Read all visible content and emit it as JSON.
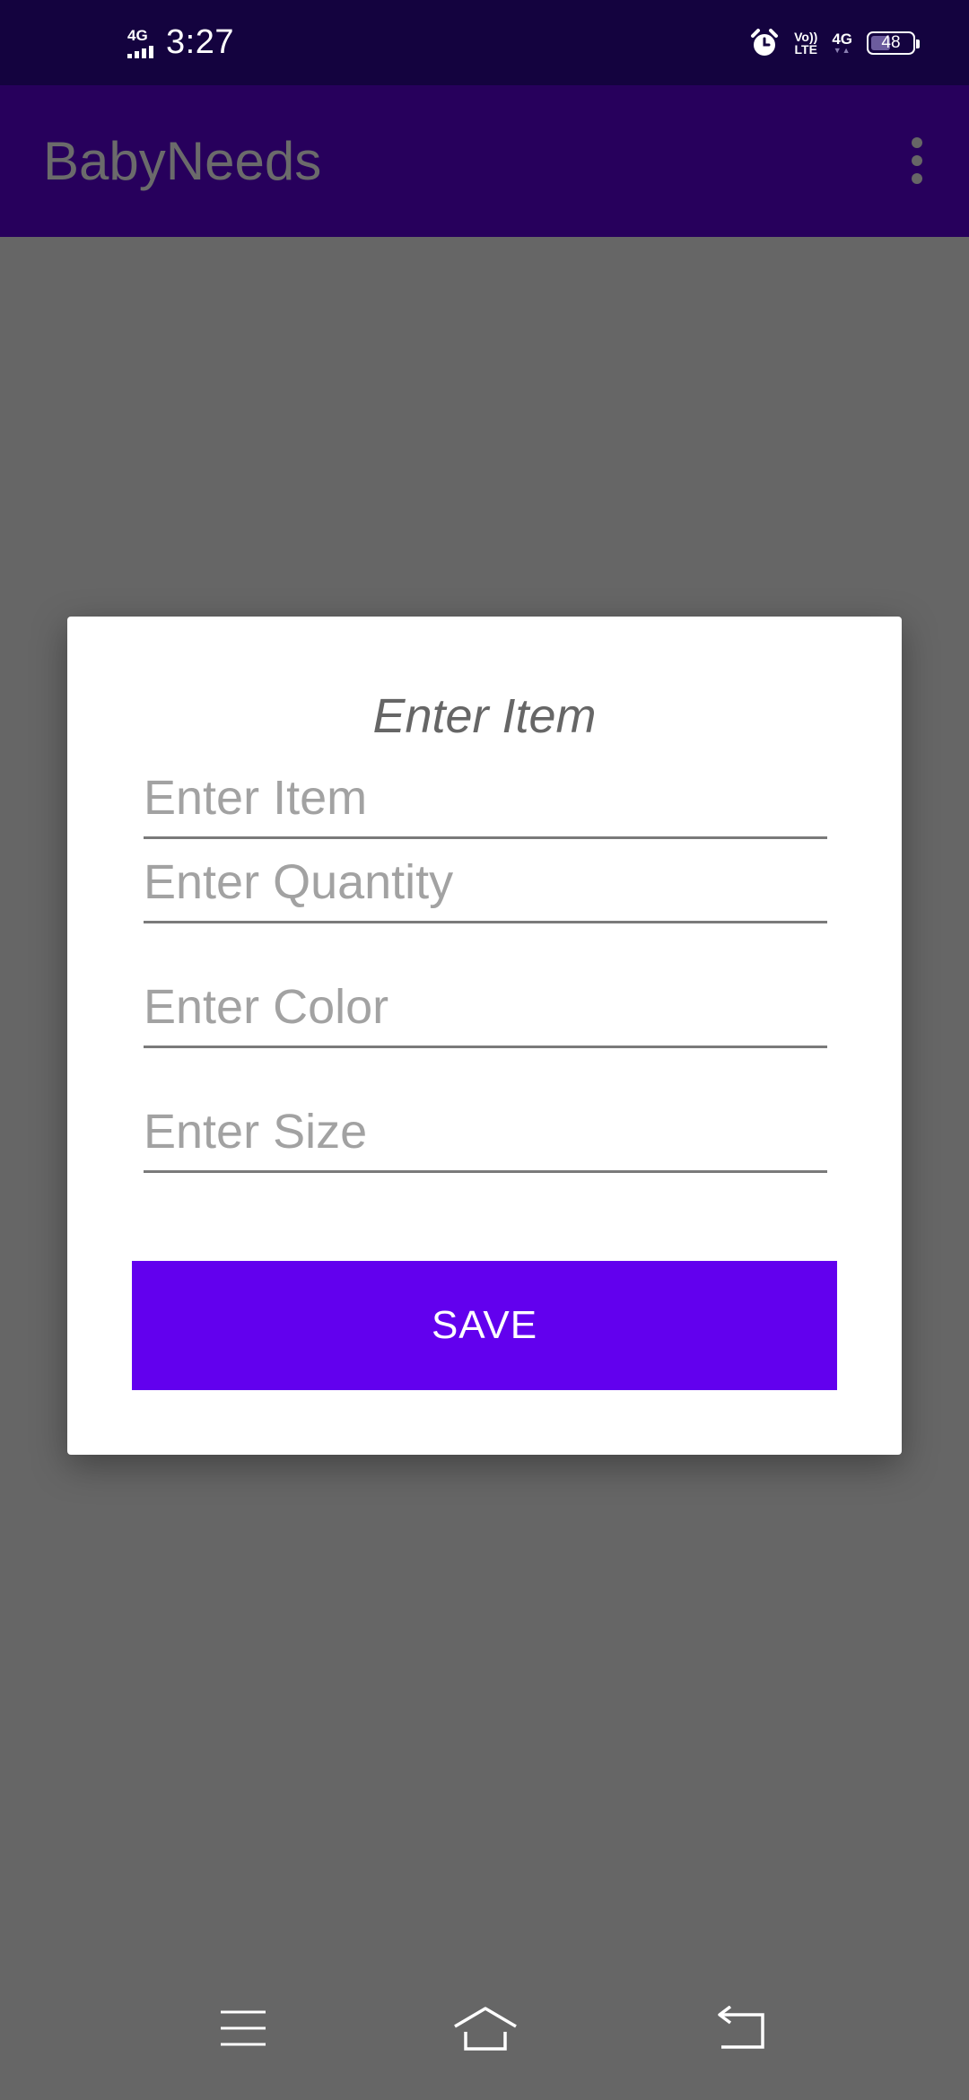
{
  "status_bar": {
    "network_left": "4G",
    "time": "3:27",
    "volte_top": "Vo))",
    "volte_bottom": "LTE",
    "network_right": "4G",
    "network_right_arrows": "▼▲",
    "battery_level": "48",
    "battery_fraction": 0.48,
    "icons": [
      "signal-icon",
      "alarm-icon",
      "volte-icon",
      "battery-icon"
    ]
  },
  "app_bar": {
    "title": "BabyNeeds",
    "menu_icon": "overflow-menu-icon",
    "background": "#27005c",
    "title_color": "#6b6b6b"
  },
  "dialog": {
    "title": "Enter Item",
    "fields": [
      {
        "placeholder": "Enter Item",
        "value": ""
      },
      {
        "placeholder": "Enter Quantity",
        "value": ""
      },
      {
        "placeholder": "Enter Color",
        "value": ""
      },
      {
        "placeholder": "Enter Size",
        "value": ""
      }
    ],
    "save_label": "SAVE",
    "save_color": "#6200ee"
  },
  "nav_bar": {
    "icons": [
      "menu-icon",
      "home-icon",
      "back-icon"
    ]
  },
  "colors": {
    "status_bar": "#14033f",
    "scrim": "#666666"
  }
}
